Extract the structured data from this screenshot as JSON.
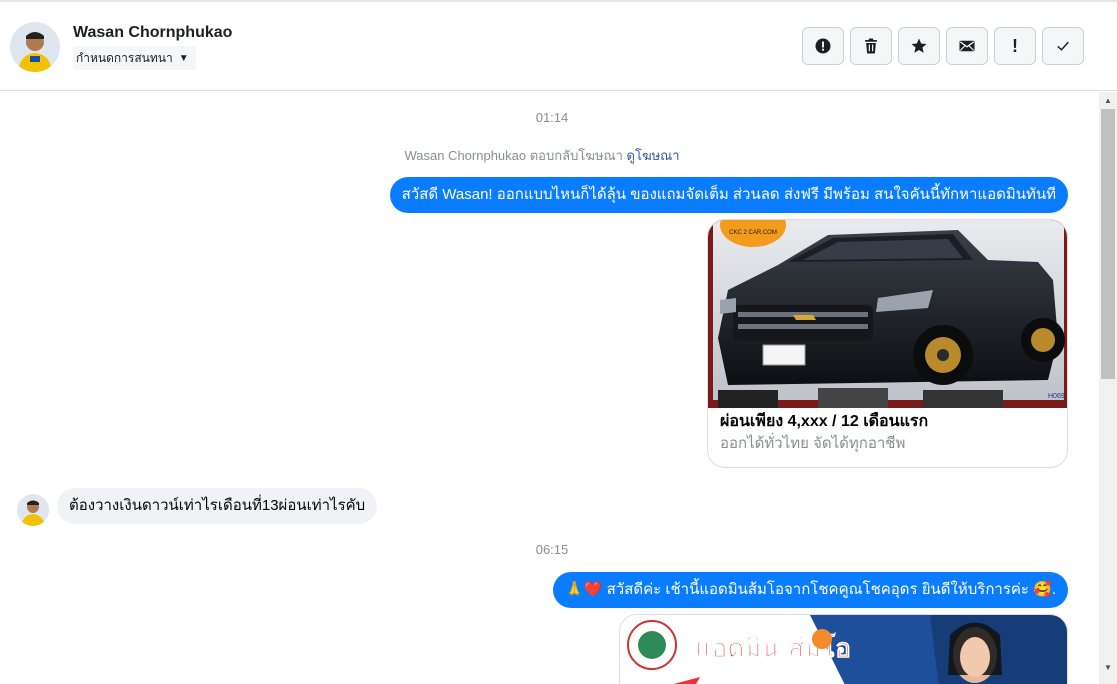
{
  "header": {
    "contact_name": "Wasan Chornphukao",
    "assign_label": "กำหนดการสนทนา",
    "actions": [
      {
        "icon": "alert-circle-icon",
        "name": "spam-button"
      },
      {
        "icon": "trash-icon",
        "name": "delete-button"
      },
      {
        "icon": "star-icon",
        "name": "star-button"
      },
      {
        "icon": "envelope-icon",
        "name": "mark-unread-button"
      },
      {
        "icon": "exclamation-icon",
        "name": "follow-up-button",
        "glyph": "!"
      },
      {
        "icon": "checkmark-icon",
        "name": "done-button",
        "glyph": "✓"
      }
    ]
  },
  "thread": {
    "time_1": "01:14",
    "reply_note": {
      "prefix": "Wasan Chornphukao ตอบกลับโฆษณา",
      "link": "ดูโฆษณา"
    },
    "msg_out_1": "สวัสดี Wasan! ออกแบบไหนก็ได้ลุ้น ของแถมจัดเต็ม ส่วนลด ส่งฟรี มีพร้อม สนใจคันนี้ทักหาแอดมินทันที",
    "card": {
      "title": "ผ่อนเพียง 4,xxx / 12 เดือนแรก",
      "subtitle": "ออกได้ทั่วไทย จัดได้ทุกอาชีพ",
      "logo_text": "CKC 2 CAR.COM",
      "plate_code": "H069"
    },
    "msg_in_1": "ต้องวางเงินดาวน์เท่าไรเดือนที่13ผ่อนเท่าไรคับ",
    "time_2": "06:15",
    "msg_out_2": "🙏❤️ สวัสดีค่ะ เช้านี้แอดมินส้มโอจากโชคคูณโชคอุดร ยินดีให้บริการค่ะ 🥰.",
    "card2": {
      "banner_text": "แอดมิน ส้มโอ"
    }
  },
  "colors": {
    "messenger_blue": "#0a7cff",
    "incoming_bubble": "#f0f2f5",
    "muted_text": "#8a8d91",
    "link": "#385898"
  }
}
